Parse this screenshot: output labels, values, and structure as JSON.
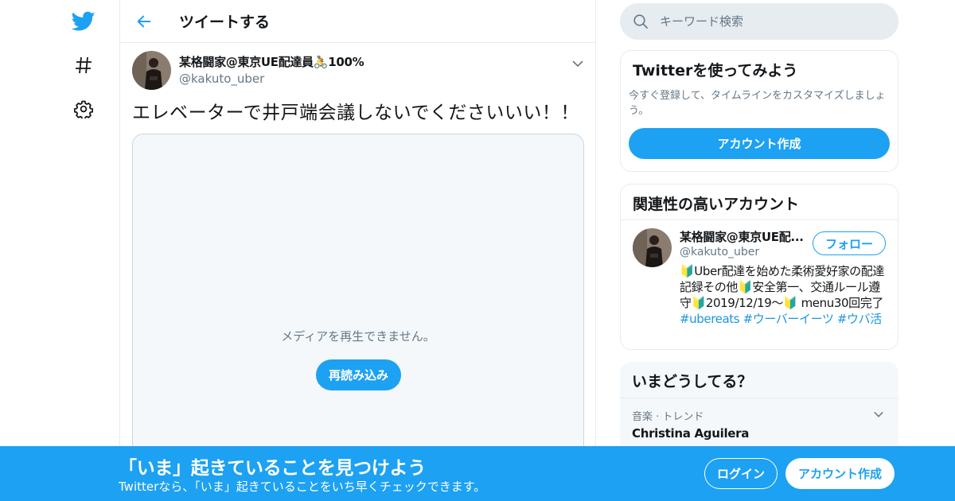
{
  "nav": {
    "icons": [
      "twitter-logo-icon",
      "hashtag-icon",
      "gear-icon"
    ],
    "accent": "#1da1f2"
  },
  "header": {
    "title": "ツイートする"
  },
  "tweet": {
    "author_name": "某格闘家@東京UE配達員🚴100%",
    "author_handle": "@kakuto_uber",
    "text": "エレベーターで井戸端会議しないでくださいいい！！",
    "media_error": "メディアを再生できません。",
    "reload_label": "再読み込み"
  },
  "search": {
    "placeholder": "キーワード検索"
  },
  "signup_card": {
    "title": "Twitterを使ってみよう",
    "description": "今すぐ登録して、タイムラインをカスタマイズしましょう。",
    "button": "アカウント作成"
  },
  "related": {
    "title": "関連性の高いアカウント",
    "user_name": "某格闘家@東京UE配...",
    "user_handle": "@kakuto_uber",
    "follow_label": "フォロー",
    "bio_text": "🔰Uber配達を始めた柔術愛好家の配達記録その他🔰安全第一、交通ルール遵守🔰2019/12/19〜🔰 menu30回完了 ",
    "hashtags": [
      "#ubereats",
      "#ウーバーイーツ",
      "#ウバ活"
    ]
  },
  "trends": {
    "title": "いまどうしてる？",
    "items": [
      {
        "meta": "音楽 · トレンド",
        "name": "Christina Aguilera"
      }
    ]
  },
  "bottom_bar": {
    "headline": "「いま」起きていることを見つけよう",
    "subtext": "Twitterなら、「いま」起きていることをいち早くチェックできます。",
    "login_label": "ログイン",
    "signup_label": "アカウント作成"
  }
}
